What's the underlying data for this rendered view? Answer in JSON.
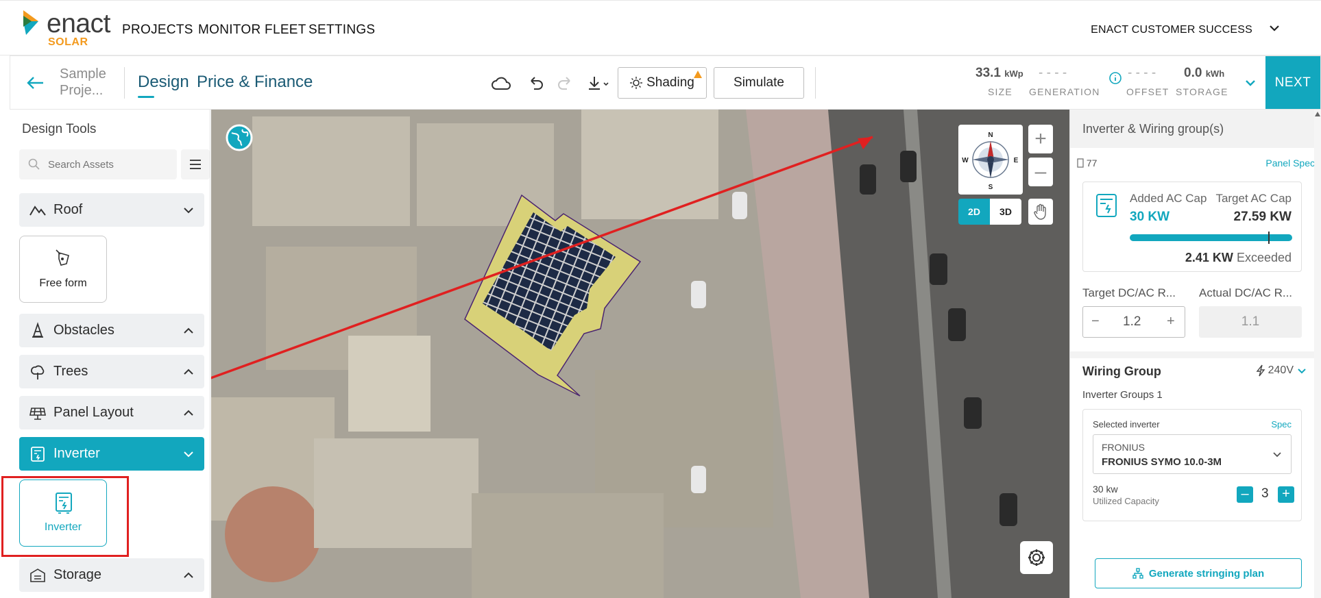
{
  "brand": {
    "name": "enact",
    "sub": "SOLAR"
  },
  "nav": {
    "projects": "PROJECTS",
    "monitor": "MONITOR FLEET",
    "settings": "SETTINGS",
    "account": "ENACT CUSTOMER SUCCESS"
  },
  "toolbar": {
    "project_name": "Sample Proje...",
    "tab_design": "Design",
    "tab_finance": "Price & Finance",
    "shading": "Shading",
    "simulate": "Simulate",
    "size_value": "33.1",
    "size_unit": "kWp",
    "size_label": "SIZE",
    "generation_value": "- - - -",
    "generation_label": "GENERATION",
    "offset_value": "- - - -",
    "offset_label": "OFFSET",
    "storage_value": "0.0",
    "storage_unit": "kWh",
    "storage_label": "STORAGE",
    "next": "NEXT"
  },
  "sidebar": {
    "title": "Design Tools",
    "search_placeholder": "Search Assets",
    "roof": "Roof",
    "free_form": "Free form",
    "obstacles": "Obstacles",
    "trees": "Trees",
    "panel_layout": "Panel Layout",
    "inverter": "Inverter",
    "inverter_tile": "Inverter",
    "storage": "Storage"
  },
  "map": {
    "view_2d": "2D",
    "view_3d": "3D",
    "compass": {
      "n": "N",
      "s": "S",
      "e": "E",
      "w": "W"
    }
  },
  "panel": {
    "title": "Inverter & Wiring group(s)",
    "panel_count": "77",
    "panel_spec": "Panel Spec",
    "added_cap_label": "Added AC Cap",
    "added_cap_value": "30 KW",
    "target_cap_label": "Target AC Cap",
    "target_cap_value": "27.59 KW",
    "cap_fill_fraction": 1.0,
    "exceeded_value": "2.41 KW",
    "exceeded_label": "Exceeded",
    "target_ratio_label": "Target DC/AC R...",
    "target_ratio_value": "1.2",
    "actual_ratio_label": "Actual DC/AC R...",
    "actual_ratio_value": "1.1",
    "wiring_group": "Wiring Group",
    "voltage": "240V",
    "inverter_groups": "Inverter Groups 1",
    "selected_inverter": "Selected inverter",
    "spec": "Spec",
    "inv_brand": "FRONIUS",
    "inv_model": "FRONIUS SYMO 10.0-3M",
    "utilized_value": "30 kw",
    "utilized_label": "Utilized Capacity",
    "quantity": "3",
    "generate": "Generate stringing plan"
  },
  "colors": {
    "accent": "#12a7be",
    "brand_orange": "#f39a1e",
    "annotation_red": "#e02020"
  }
}
